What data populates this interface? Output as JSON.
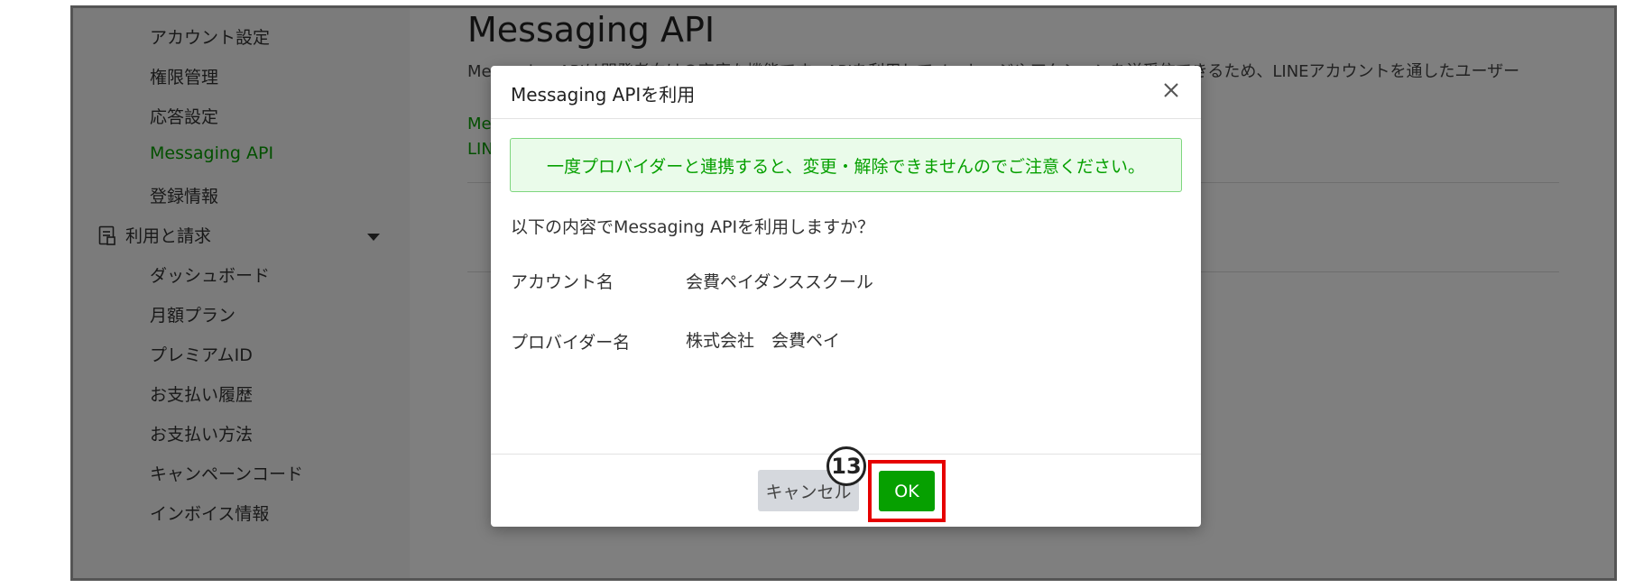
{
  "sidebar": {
    "items": [
      {
        "label": "アカウント設定",
        "active": false
      },
      {
        "label": "権限管理",
        "active": false
      },
      {
        "label": "応答設定",
        "active": false
      },
      {
        "label": "Messaging API",
        "active": true
      },
      {
        "label": "登録情報",
        "active": false
      }
    ],
    "section": {
      "label": "利用と請求",
      "icon": "document-icon"
    },
    "section_items": [
      {
        "label": "ダッシュボード"
      },
      {
        "label": "月額プラン"
      },
      {
        "label": "プレミアムID"
      },
      {
        "label": "お支払い履歴"
      },
      {
        "label": "お支払い方法"
      },
      {
        "label": "キャンペーンコード"
      },
      {
        "label": "インボイス情報"
      }
    ]
  },
  "main": {
    "title": "Messaging API",
    "description": "Messaging APIは開発者向けの高度な機能です。APIを利用してメッセージやアクションを送受信できるため、LINEアカウントを通したユーザー",
    "link1": "Me",
    "link2": "LIN"
  },
  "modal": {
    "title": "Messaging APIを利用",
    "alert": "一度プロバイダーと連携すると、変更・解除できませんのでご注意ください。",
    "question": "以下の内容でMessaging APIを利用しますか？",
    "account_label": "アカウント名",
    "account_value": "会費ペイダンススクール",
    "provider_label": "プロバイダー名",
    "provider_value": "株式会社　会費ペイ",
    "cancel_label": "キャンセル",
    "ok_label": "OK"
  },
  "annotation": {
    "step": "13"
  },
  "colors": {
    "accent": "#06a000",
    "highlight": "#e60000"
  }
}
